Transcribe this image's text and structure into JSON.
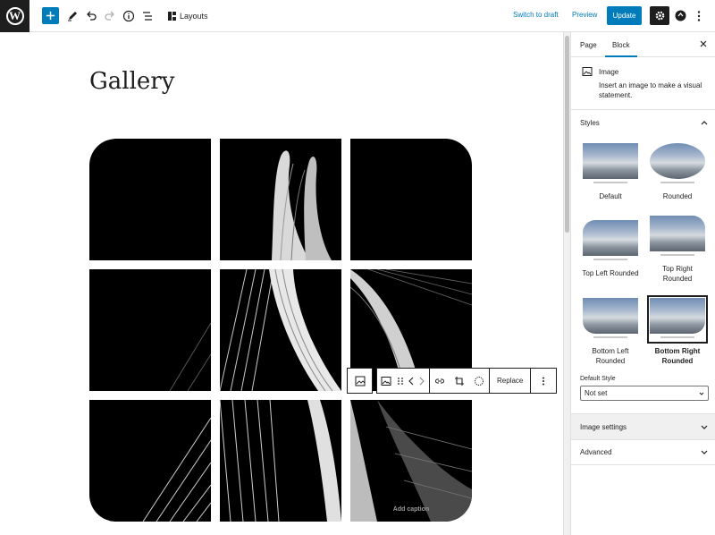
{
  "topbar": {
    "logo_letter": "W",
    "layouts_label": "Layouts",
    "switch_draft_label": "Switch to draft",
    "preview_label": "Preview",
    "update_label": "Update"
  },
  "canvas": {
    "page_title": "Gallery",
    "caption_placeholder": "Add caption"
  },
  "block_toolbar": {
    "replace_label": "Replace"
  },
  "sidebar": {
    "tabs": [
      {
        "label": "Page"
      },
      {
        "label": "Block"
      }
    ],
    "block": {
      "title": "Image",
      "description": "Insert an image to make a visual statement."
    },
    "styles_title": "Styles",
    "style_options": [
      {
        "label": "Default"
      },
      {
        "label": "Rounded"
      },
      {
        "label": "Top Left Rounded"
      },
      {
        "label": "Top Right Rounded"
      },
      {
        "label": "Bottom Left Rounded"
      },
      {
        "label": "Bottom Right Rounded"
      }
    ],
    "default_style_label": "Default Style",
    "default_style_value": "Not set",
    "image_settings_title": "Image settings",
    "advanced_title": "Advanced"
  },
  "colors": {
    "accent": "#007cba",
    "dark": "#1e1e1e"
  }
}
